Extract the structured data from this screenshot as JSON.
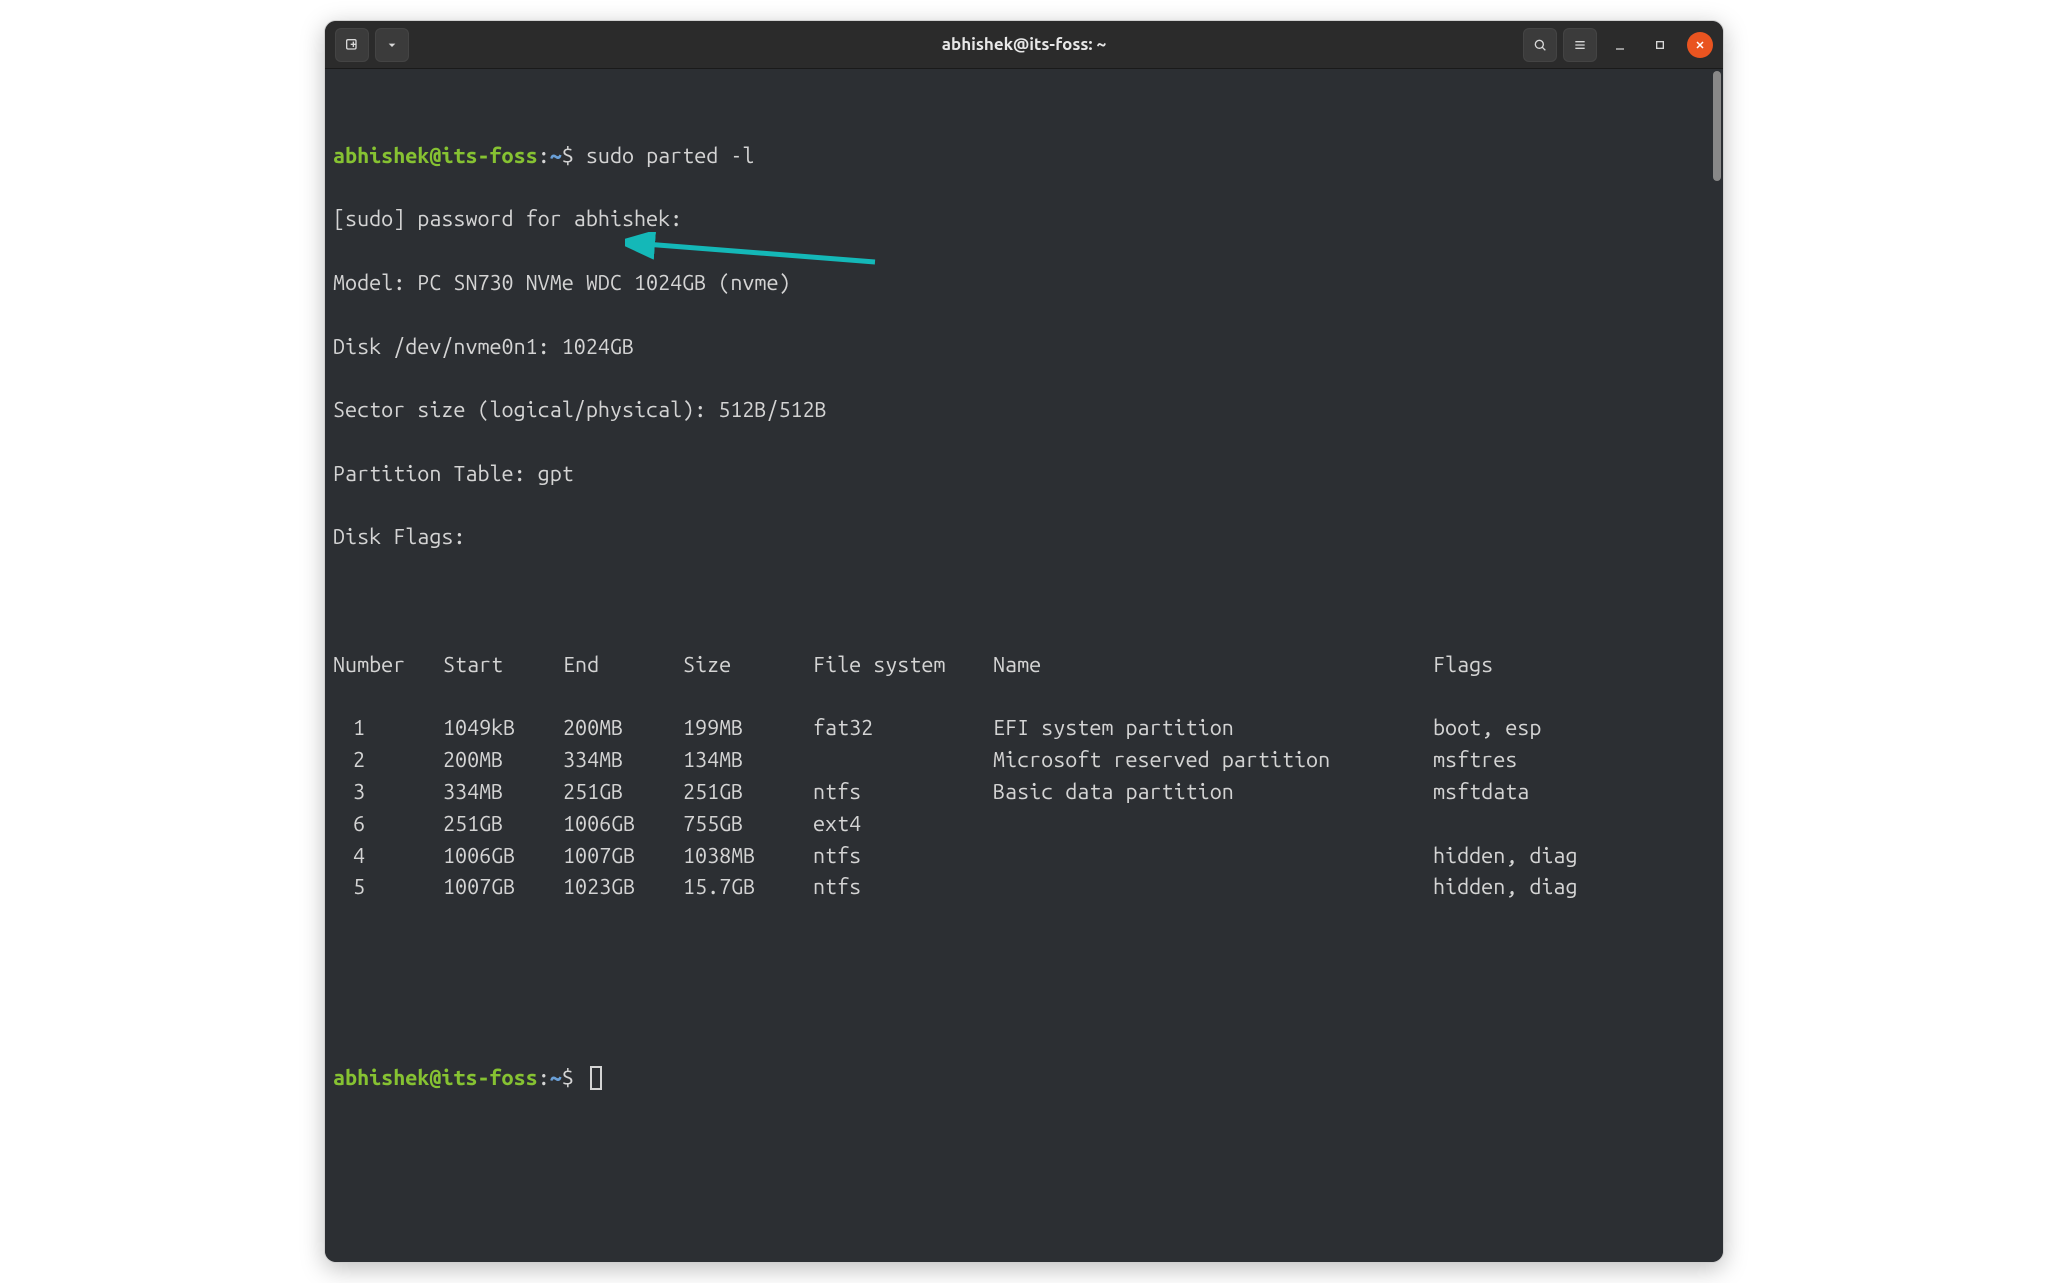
{
  "window": {
    "title": "abhishek@its-foss: ~"
  },
  "prompt": {
    "userhost": "abhishek@its-foss",
    "sep": ":",
    "path": "~",
    "dollar": "$"
  },
  "command": "sudo parted -l",
  "output": {
    "sudo_prompt": "[sudo] password for abhishek:",
    "model": "Model: PC SN730 NVMe WDC 1024GB (nvme)",
    "disk": "Disk /dev/nvme0n1: 1024GB",
    "sector": "Sector size (logical/physical): 512B/512B",
    "ptable": "Partition Table: gpt",
    "flags": "Disk Flags:"
  },
  "table": {
    "headers": {
      "num": "Number",
      "start": "Start",
      "end": "End",
      "size": "Size",
      "fs": "File system",
      "name": "Name",
      "flags": "Flags"
    },
    "rows": [
      {
        "num": "1",
        "start": "1049kB",
        "end": "200MB",
        "size": "199MB",
        "fs": "fat32",
        "name": "EFI system partition",
        "flags": "boot, esp"
      },
      {
        "num": "2",
        "start": "200MB",
        "end": "334MB",
        "size": "134MB",
        "fs": "",
        "name": "Microsoft reserved partition",
        "flags": "msftres"
      },
      {
        "num": "3",
        "start": "334MB",
        "end": "251GB",
        "size": "251GB",
        "fs": "ntfs",
        "name": "Basic data partition",
        "flags": "msftdata"
      },
      {
        "num": "6",
        "start": "251GB",
        "end": "1006GB",
        "size": "755GB",
        "fs": "ext4",
        "name": "",
        "flags": ""
      },
      {
        "num": "4",
        "start": "1006GB",
        "end": "1007GB",
        "size": "1038MB",
        "fs": "ntfs",
        "name": "",
        "flags": "hidden, diag"
      },
      {
        "num": "5",
        "start": "1007GB",
        "end": "1023GB",
        "size": "15.7GB",
        "fs": "ntfs",
        "name": "",
        "flags": "hidden, diag"
      }
    ]
  }
}
